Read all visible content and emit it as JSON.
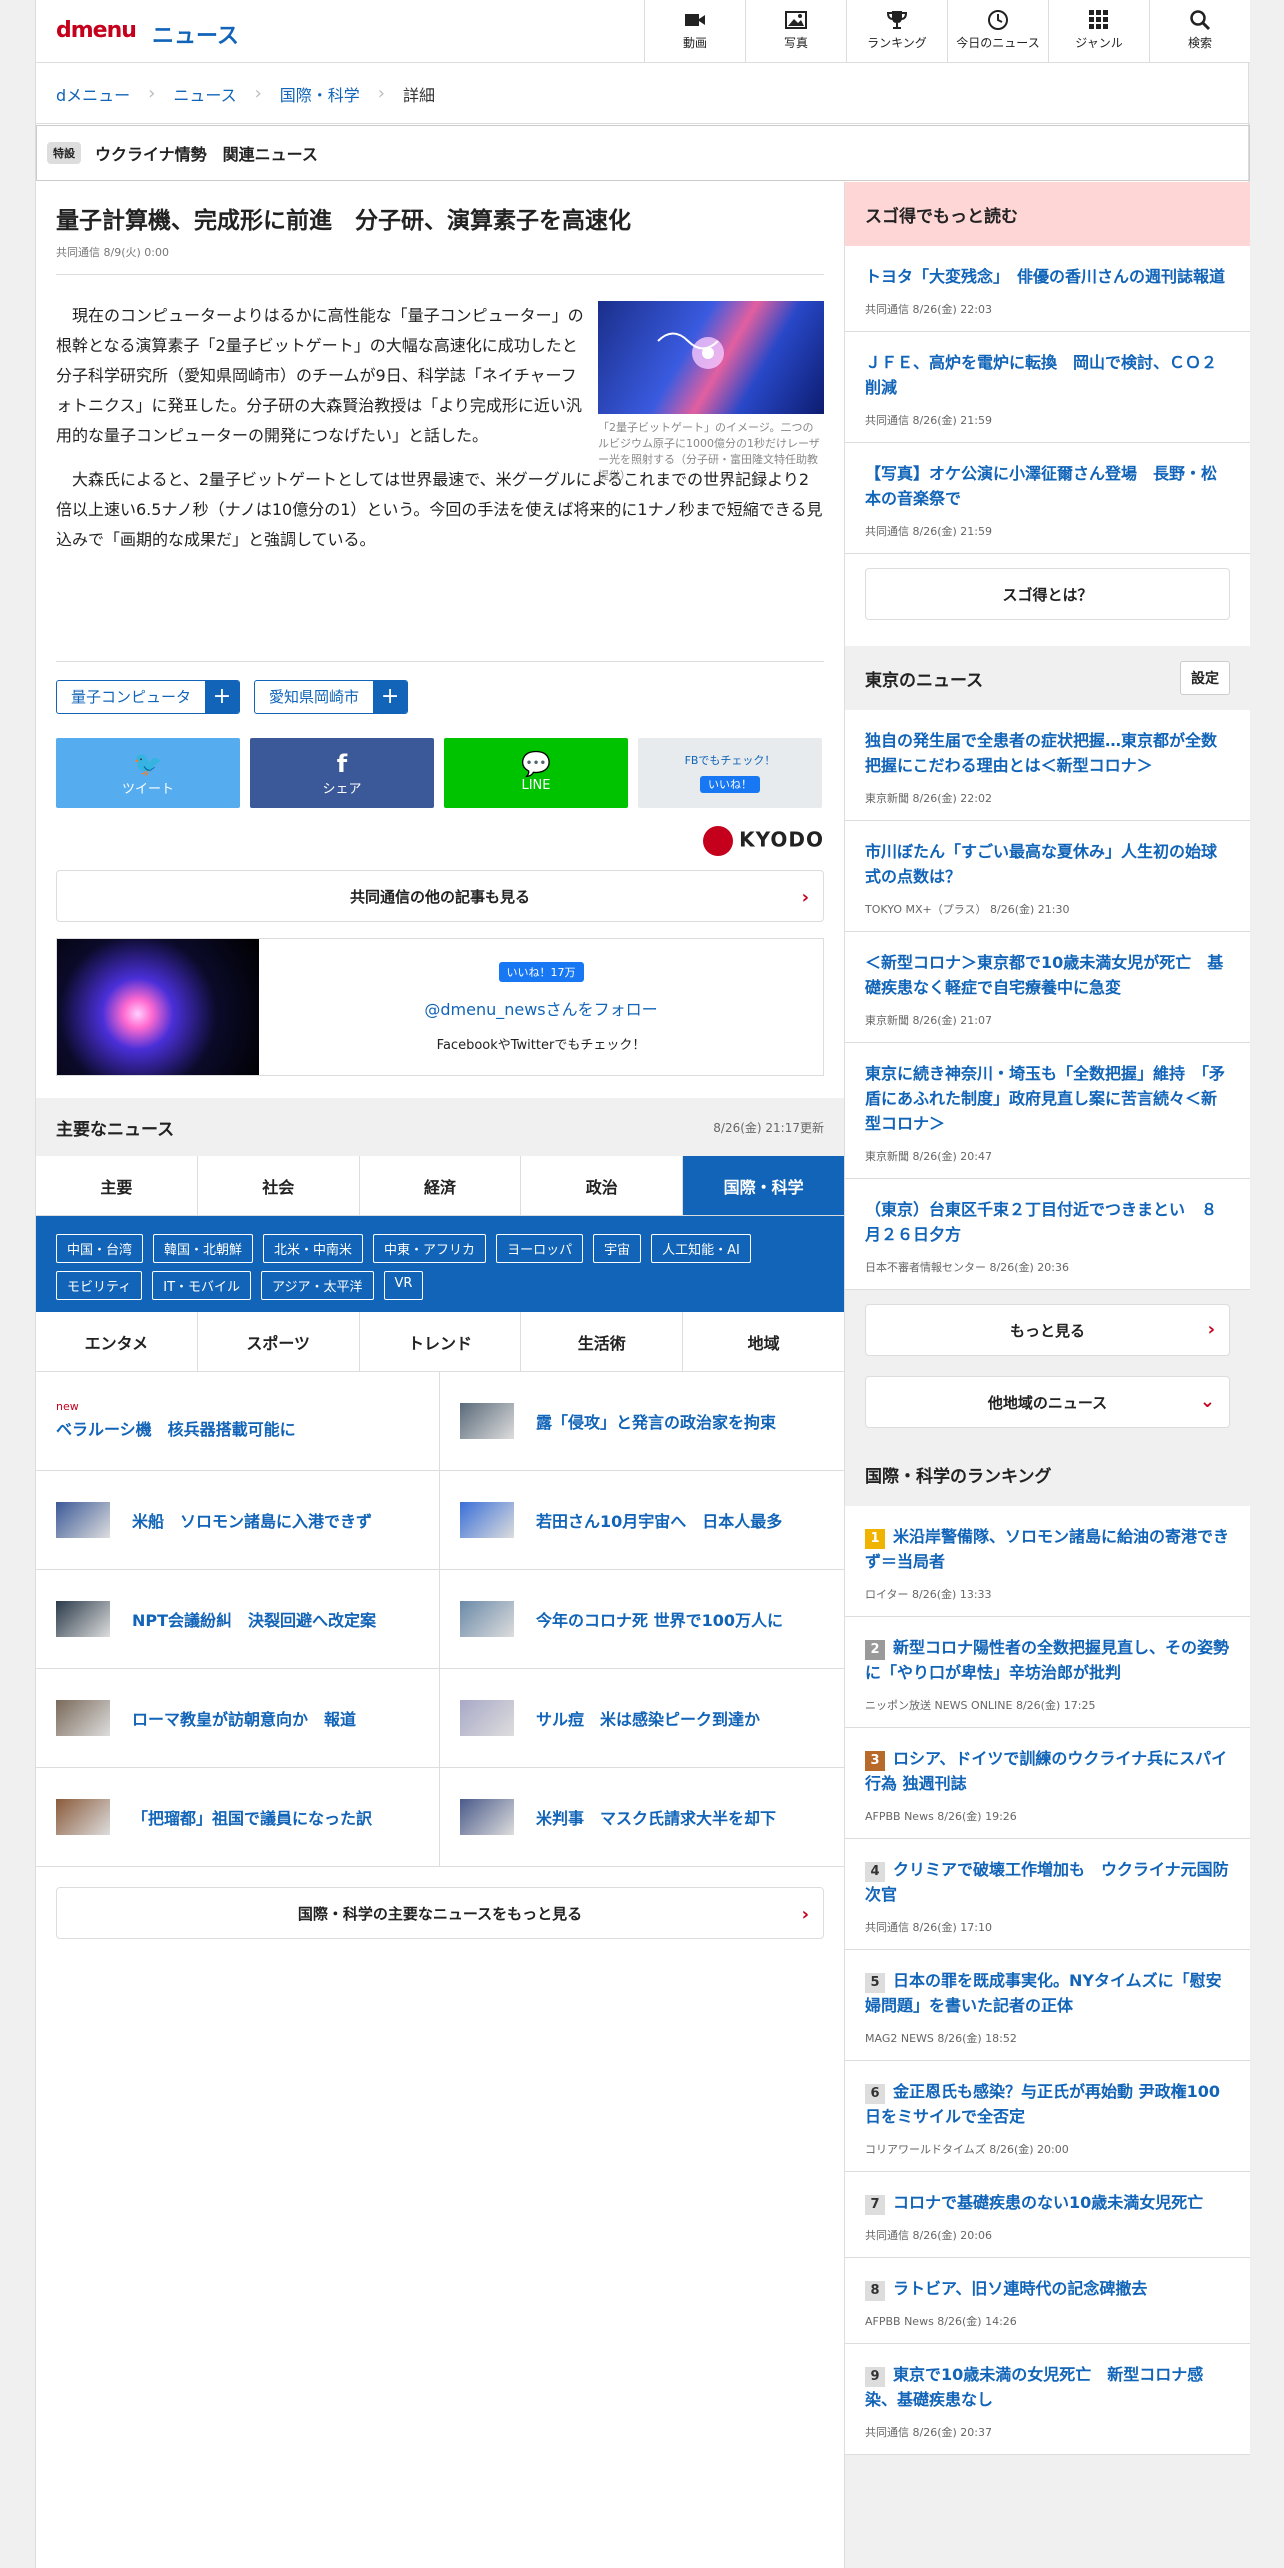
{
  "header": {
    "logo": "dmenu",
    "site": "ニュース",
    "nav": [
      {
        "label": "動画",
        "icon": "video-icon"
      },
      {
        "label": "写真",
        "icon": "photo-icon"
      },
      {
        "label": "ランキング",
        "icon": "trophy-icon"
      },
      {
        "label": "今日のニュース",
        "icon": "clock-icon"
      },
      {
        "label": "ジャンル",
        "icon": "grid-icon"
      },
      {
        "label": "検索",
        "icon": "search-icon"
      }
    ]
  },
  "breadcrumb": [
    "dメニュー",
    "ニュース",
    "国際・科学",
    "詳細"
  ],
  "special": {
    "badge": "特設",
    "title": "ウクライナ情勢　関連ニュース"
  },
  "article": {
    "title": "量子計算機、完成形に前進　分子研、演算素子を高速化",
    "meta": "共同通信 8/9(火) 0:00",
    "p1": "現在のコンピューターよりはるかに高性能な「量子コンピューター」の根幹となる演算素子「2量子ビットゲート」の大幅な高速化に成功したと分子科学研究所（愛知県岡崎市）のチームが9日、科学誌「ネイチャーフォトニクス」に発표した。分子研の大森賢治教授は「より完成形に近い汎用的な量子コンピューターの開発につなげたい」と話した。",
    "p2": "大森氏によると、2量子ビットゲートとしては世界最速で、米グーグルによるこれまでの世界記録より2倍以上速い6.5ナノ秒（ナノは10億分の1）という。今回の手法を使えば将来的に1ナノ秒まで短縮できる見込みで「画期的な成果だ」と強調している。",
    "caption": "「2量子ビットゲート」のイメージ。二つのルビジウム原子に1000億分の1秒だけレーザー光を照射する（分子研・富田隆文特任助教提供）",
    "tags": [
      "量子コンピュータ",
      "愛知県岡崎市"
    ],
    "share": [
      {
        "label": "ツイート",
        "color": "#55acee",
        "icon": "twitter-icon"
      },
      {
        "label": "シェア",
        "color": "#3b5998",
        "icon": "facebook-icon"
      },
      {
        "label": "LINE",
        "color": "#00c300",
        "icon": "line-icon"
      }
    ],
    "fb_check": "FBでもチェック！",
    "fb_like": "いいね！",
    "source_logo": "KYODO",
    "more": "共同通信の他の記事も見る",
    "follow": {
      "like": "いいね！17万",
      "handle": "@dmenu_newsさんをフォロー",
      "sub": "FacebookやTwitterでもチェック！"
    }
  },
  "major": {
    "title": "主要なニュース",
    "updated": "8/26(金) 21:17更新",
    "tabs1": [
      "主要",
      "社会",
      "経済",
      "政治",
      "国際・科学"
    ],
    "active": "国際・科学",
    "subtags": [
      "中国・台湾",
      "韓国・北朝鮮",
      "北米・中南米",
      "中東・アフリカ",
      "ヨーロッパ",
      "宇宙",
      "人工知能・AI",
      "モビリティ",
      "IT・モバイル",
      "アジア・太平洋",
      "VR"
    ],
    "tabs2": [
      "エンタメ",
      "スポーツ",
      "トレンド",
      "生活術",
      "地域"
    ],
    "items": [
      {
        "t": "ベラルーシ機　核兵器搭載可能に",
        "new": "new",
        "img": false
      },
      {
        "t": "露「侵攻」と発言の政治家を拘束",
        "img": true
      },
      {
        "t": "米船　ソロモン諸島に入港できず",
        "img": true
      },
      {
        "t": "若田さん10月宇宙へ　日本人最多",
        "img": true
      },
      {
        "t": "NPT会議紛糾　決裂回避へ改定案",
        "img": true
      },
      {
        "t": "今年のコロナ死 世界で100万人に",
        "img": true
      },
      {
        "t": "ローマ教皇が訪朝意向か　報道",
        "img": true
      },
      {
        "t": "サル痘　米は感染ピーク到達か",
        "img": true
      },
      {
        "t": "「把瑠都」祖国で議員になった訳",
        "img": true
      },
      {
        "t": "米判事　マスク氏請求大半を却下",
        "img": true
      }
    ],
    "more": "国際・科学の主要なニュースをもっと見る"
  },
  "side": {
    "sugotoku": {
      "title": "スゴ得でもっと読む",
      "items": [
        {
          "t": "トヨタ「大変残念」　俳優の香川さんの週刊誌報道",
          "m": "共同通信 8/26(金) 22:03"
        },
        {
          "t": "ＪＦＥ、高炉を電炉に転換　岡山で検討、ＣＯ２削減",
          "m": "共同通信 8/26(金) 21:59"
        },
        {
          "t": "【写真】オケ公演に小澤征爾さん登場　長野・松本の音楽祭で",
          "m": "共同通信 8/26(金) 21:59"
        }
      ],
      "btn": "スゴ得とは？"
    },
    "tokyo": {
      "title": "東京のニュース",
      "setting": "設定",
      "items": [
        {
          "t": "独自の発生届で全患者の症状把握…東京都が全数把握にこだわる理由とは＜新型コロナ＞",
          "m": "東京新聞 8/26(金) 22:02"
        },
        {
          "t": "市川ぼたん「すごい最高な夏休み」人生初の始球式の点数は？",
          "m": "TOKYO MX+（プラス） 8/26(金) 21:30"
        },
        {
          "t": "＜新型コロナ＞東京都で10歳未満女児が死亡　基礎疾患なく軽症で自宅療養中に急変",
          "m": "東京新聞 8/26(金) 21:07"
        },
        {
          "t": "東京に続き神奈川・埼玉も「全数把握」維持　「矛盾にあふれた制度」政府見直し案に苦言続々＜新型コロナ＞",
          "m": "東京新聞 8/26(金) 20:47"
        },
        {
          "t": "（東京）台東区千束２丁目付近でつきまとい　８月２６日夕方",
          "m": "日本不審者情報センター 8/26(金) 20:36"
        }
      ],
      "more": "もっと見る",
      "other": "他地域のニュース"
    },
    "ranking": {
      "title": "国際・科学のランキング",
      "items": [
        {
          "n": "1",
          "c": "#f0b400",
          "t": "米沿岸警備隊、ソロモン諸島に給油の寄港できず＝当局者",
          "m": "ロイター 8/26(金) 13:33"
        },
        {
          "n": "2",
          "c": "#9a9a9a",
          "t": "新型コロナ陽性者の全数把握見直し、その姿勢に「やり口が卑怯」辛坊治郎が批判",
          "m": "ニッポン放送 NEWS ONLINE 8/26(金) 17:25"
        },
        {
          "n": "3",
          "c": "#b86a2a",
          "t": "ロシア、ドイツで訓練のウクライナ兵にスパイ行為 独週刊誌",
          "m": "AFPBB News 8/26(金) 19:26"
        },
        {
          "n": "4",
          "c": "#ddd",
          "t": "クリミアで破壊工作増加も　ウクライナ元国防次官",
          "m": "共同通信 8/26(金) 17:10"
        },
        {
          "n": "5",
          "c": "#ddd",
          "t": "日本の罪を既成事実化。NYタイムズに「慰安婦問題」を書いた記者の正体",
          "m": "MAG2 NEWS 8/26(金) 18:52"
        },
        {
          "n": "6",
          "c": "#ddd",
          "t": "金正恩氏も感染？与正氏が再始動 尹政権100日をミサイルで全否定",
          "m": "コリアワールドタイムズ 8/26(金) 20:00"
        },
        {
          "n": "7",
          "c": "#ddd",
          "t": "コロナで基礎疾患のない10歳未満女児死亡",
          "m": "共同通信 8/26(金) 20:06"
        },
        {
          "n": "8",
          "c": "#ddd",
          "t": "ラトビア、旧ソ連時代の記念碑撤去",
          "m": "AFPBB News 8/26(金) 14:26"
        },
        {
          "n": "9",
          "c": "#ddd",
          "t": "東京で10歳未満の女児死亡　新型コロナ感染、基礎疾患なし",
          "m": "共同通信 8/26(金) 20:37"
        }
      ]
    }
  }
}
